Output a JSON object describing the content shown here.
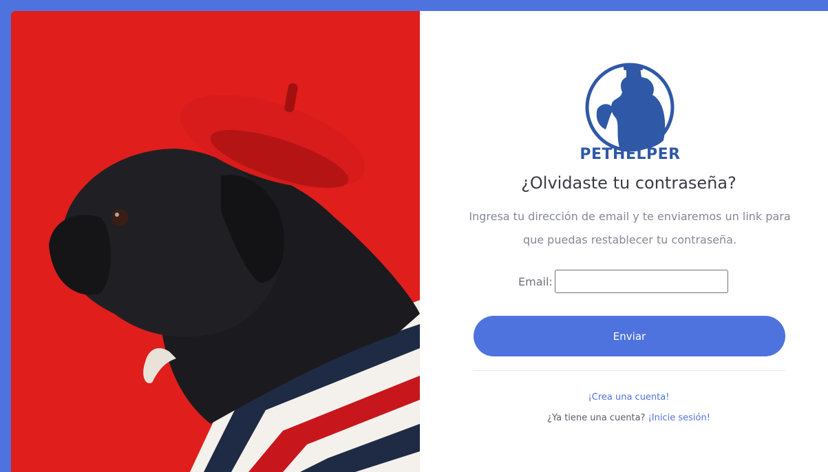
{
  "brand": {
    "name": "PETHELPER"
  },
  "form": {
    "title": "¿Olvidaste tu contraseña?",
    "description": "Ingresa tu dirección de email y te enviaremos un link para que puedas restablecer tu contraseña.",
    "email_label": "Email:",
    "email_value": "",
    "submit_label": "Enviar"
  },
  "links": {
    "create_account": "¡Crea una cuenta!",
    "have_account_text": "¿Ya tiene una cuenta?",
    "login": "¡Inicie sesión!"
  },
  "colors": {
    "primary": "#4e73df",
    "brand_blue": "#2f58a6",
    "photo_red": "#e01e1c"
  }
}
